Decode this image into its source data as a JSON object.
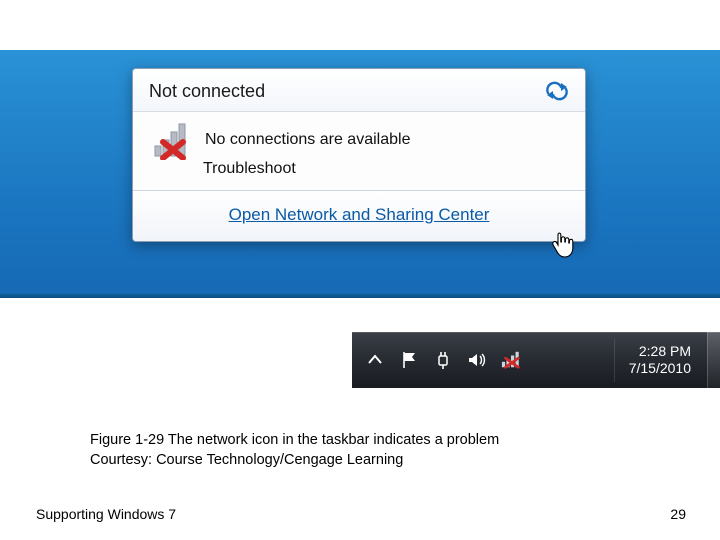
{
  "popup": {
    "title": "Not connected",
    "status": "No connections are available",
    "troubleshoot": "Troubleshoot",
    "open_link": "Open Network and Sharing Center"
  },
  "taskbar": {
    "time": "2:28 PM",
    "date": "7/15/2010"
  },
  "caption": {
    "line1": "Figure 1-29 The network icon in the taskbar indicates a problem",
    "line2": "Courtesy: Course Technology/Cengage Learning"
  },
  "footer": {
    "title": "Supporting Windows 7",
    "page": "29"
  }
}
